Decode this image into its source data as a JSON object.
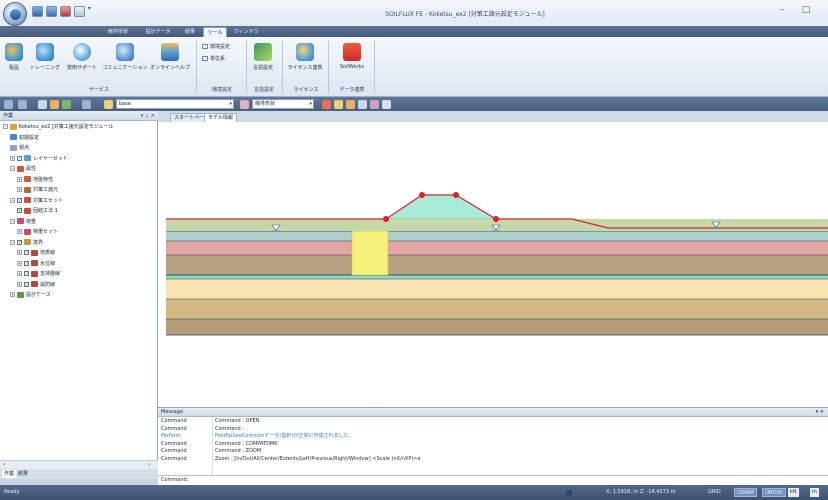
{
  "window": {
    "title": "SOILFLUX FE - Koketsu_ex2 [対策工諸元設定モジュール]",
    "minimize": "–",
    "maximize": "□"
  },
  "ribbon_tabs": [
    "條件形状",
    "設計データ",
    "結果",
    "ツール",
    "ウィンドウ"
  ],
  "ribbon": {
    "buttons": [
      "製品",
      "トレーニング",
      "技術サポート",
      "コミュニケーション",
      "オンラインヘルプ",
      "言語設定",
      "ライセンス連携",
      "SoilWorks"
    ],
    "small": [
      "環境設定",
      "単位系"
    ],
    "groups": [
      "サービス",
      "環境設定",
      "言語設定",
      "ライセンス",
      "データ連携"
    ]
  },
  "toolbar": {
    "combo1": "base",
    "combo2": "條件形状"
  },
  "tree": {
    "header": "作業",
    "controls": "▾ ⊥ ✕",
    "items": [
      {
        "label": "Koketsu_ex2 [対策工諸元設定モジュール",
        "level": 0,
        "exp": "−",
        "chk": false,
        "color": "#e2a23c"
      },
      {
        "label": "初期設定",
        "level": 1,
        "exp": "",
        "chk": false,
        "color": "#4a86c8"
      },
      {
        "label": "視点",
        "level": 1,
        "exp": "",
        "chk": false,
        "color": "#8aa1c2"
      },
      {
        "label": "レイヤーセット",
        "level": 1,
        "exp": "+",
        "chk": true,
        "color": "#5aa0d8"
      },
      {
        "label": "属性",
        "level": 1,
        "exp": "−",
        "chk": false,
        "color": "#c85a3c"
      },
      {
        "label": "地盤特性",
        "level": 2,
        "exp": "+",
        "chk": false,
        "color": "#c8603c"
      },
      {
        "label": "対策工諸元",
        "level": 2,
        "exp": "+",
        "chk": false,
        "color": "#b07030"
      },
      {
        "label": "対策工セット",
        "level": 1,
        "exp": "−",
        "chk": true,
        "color": "#c8503c"
      },
      {
        "label": "固結工法 1",
        "level": 2,
        "exp": "",
        "chk": true,
        "color": "#c84a3c"
      },
      {
        "label": "荷重",
        "level": 1,
        "exp": "−",
        "chk": false,
        "color": "#d04a70"
      },
      {
        "label": "荷重セット",
        "level": 2,
        "exp": "+",
        "chk": false,
        "color": "#d04a70"
      },
      {
        "label": "境界",
        "level": 1,
        "exp": "−",
        "chk": true,
        "color": "#c89a30"
      },
      {
        "label": "地表線",
        "level": 2,
        "exp": "+",
        "chk": true,
        "color": "#b04a3c"
      },
      {
        "label": "水位線",
        "level": 2,
        "exp": "+",
        "chk": true,
        "color": "#b04a3c"
      },
      {
        "label": "支持層線",
        "level": 2,
        "exp": "+",
        "chk": true,
        "color": "#b04a3c"
      },
      {
        "label": "堤防線",
        "level": 2,
        "exp": "+",
        "chk": true,
        "color": "#b04a3c"
      },
      {
        "label": "設計ケース",
        "level": 1,
        "exp": "+",
        "chk": false,
        "color": "#5a9a4a"
      }
    ],
    "tabs": [
      "作業",
      "結果"
    ]
  },
  "doc_tabs": [
    "スタートページ",
    "モデル情報"
  ],
  "message": {
    "header": "Message",
    "controls": "▾ ✕",
    "rows": [
      {
        "source": "Command",
        "text": "Command : OPEN",
        "color": "#1e2a3a"
      },
      {
        "source": "Command",
        "text": "Command :",
        "color": "#1e2a3a"
      },
      {
        "source": "Perform",
        "text": "PostFailureCommonデータ(指針)が正常に作成されました。",
        "color": "#2d7fd0"
      },
      {
        "source": "Command",
        "text": "Command : COMPATDMK",
        "color": "#1e2a3a"
      },
      {
        "source": "Command",
        "text": "Command : ZOOM",
        "color": "#1e2a3a"
      },
      {
        "source": "Command",
        "text": "Zoom : [In/Out/All/Center/Extents/Left/Previous/Right/Window] <Scale (nX/nXP)>a",
        "color": "#1e2a3a"
      }
    ],
    "command_prompt": "Command:"
  },
  "status": {
    "ready": "Ready",
    "coords": "X: 1.5918, m Z: -14.4573 m",
    "grid": "GRID",
    "osnap": "OSNAP",
    "ortho": "ORTHO",
    "unit_force": "kN",
    "unit_length": "m"
  },
  "colors": {
    "accent": "#4f6f9a",
    "embankment": "#a8ecd8",
    "improvement": "#f4f07a",
    "boundary": "#d8222c",
    "water": "#2c8a70"
  }
}
